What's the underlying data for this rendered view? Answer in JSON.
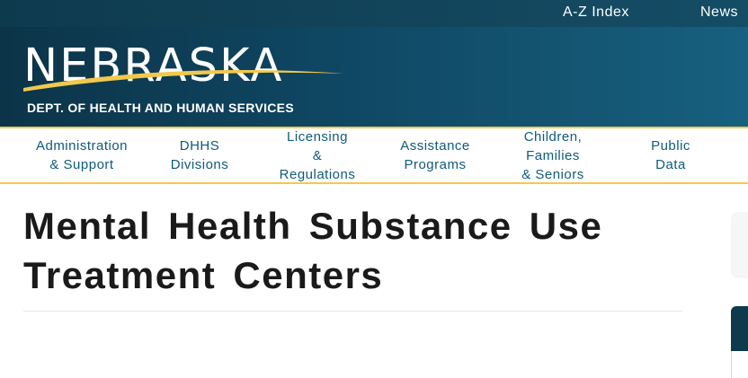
{
  "topbar": {
    "links": [
      "A-Z  Index",
      "News"
    ]
  },
  "logo": {
    "name": "NEBRASKA",
    "subtitle": "DEPT. OF HEALTH AND HUMAN SERVICES"
  },
  "nav": {
    "items": [
      "Administration\n&  Support",
      "DHHS\nDivisions",
      "Licensing\n&\nRegulations",
      "Assistance\nPrograms",
      "Children,\nFamilies\n&  Seniors",
      "Public\nData"
    ]
  },
  "page": {
    "title": "Mental Health Substance Use Treatment Centers"
  },
  "colors": {
    "header_dark": "#0c3448",
    "header_light": "#17607f",
    "accent_gold": "#f2c94c",
    "nav_text": "#0f5b7a",
    "title_text": "#1a1a1a"
  }
}
